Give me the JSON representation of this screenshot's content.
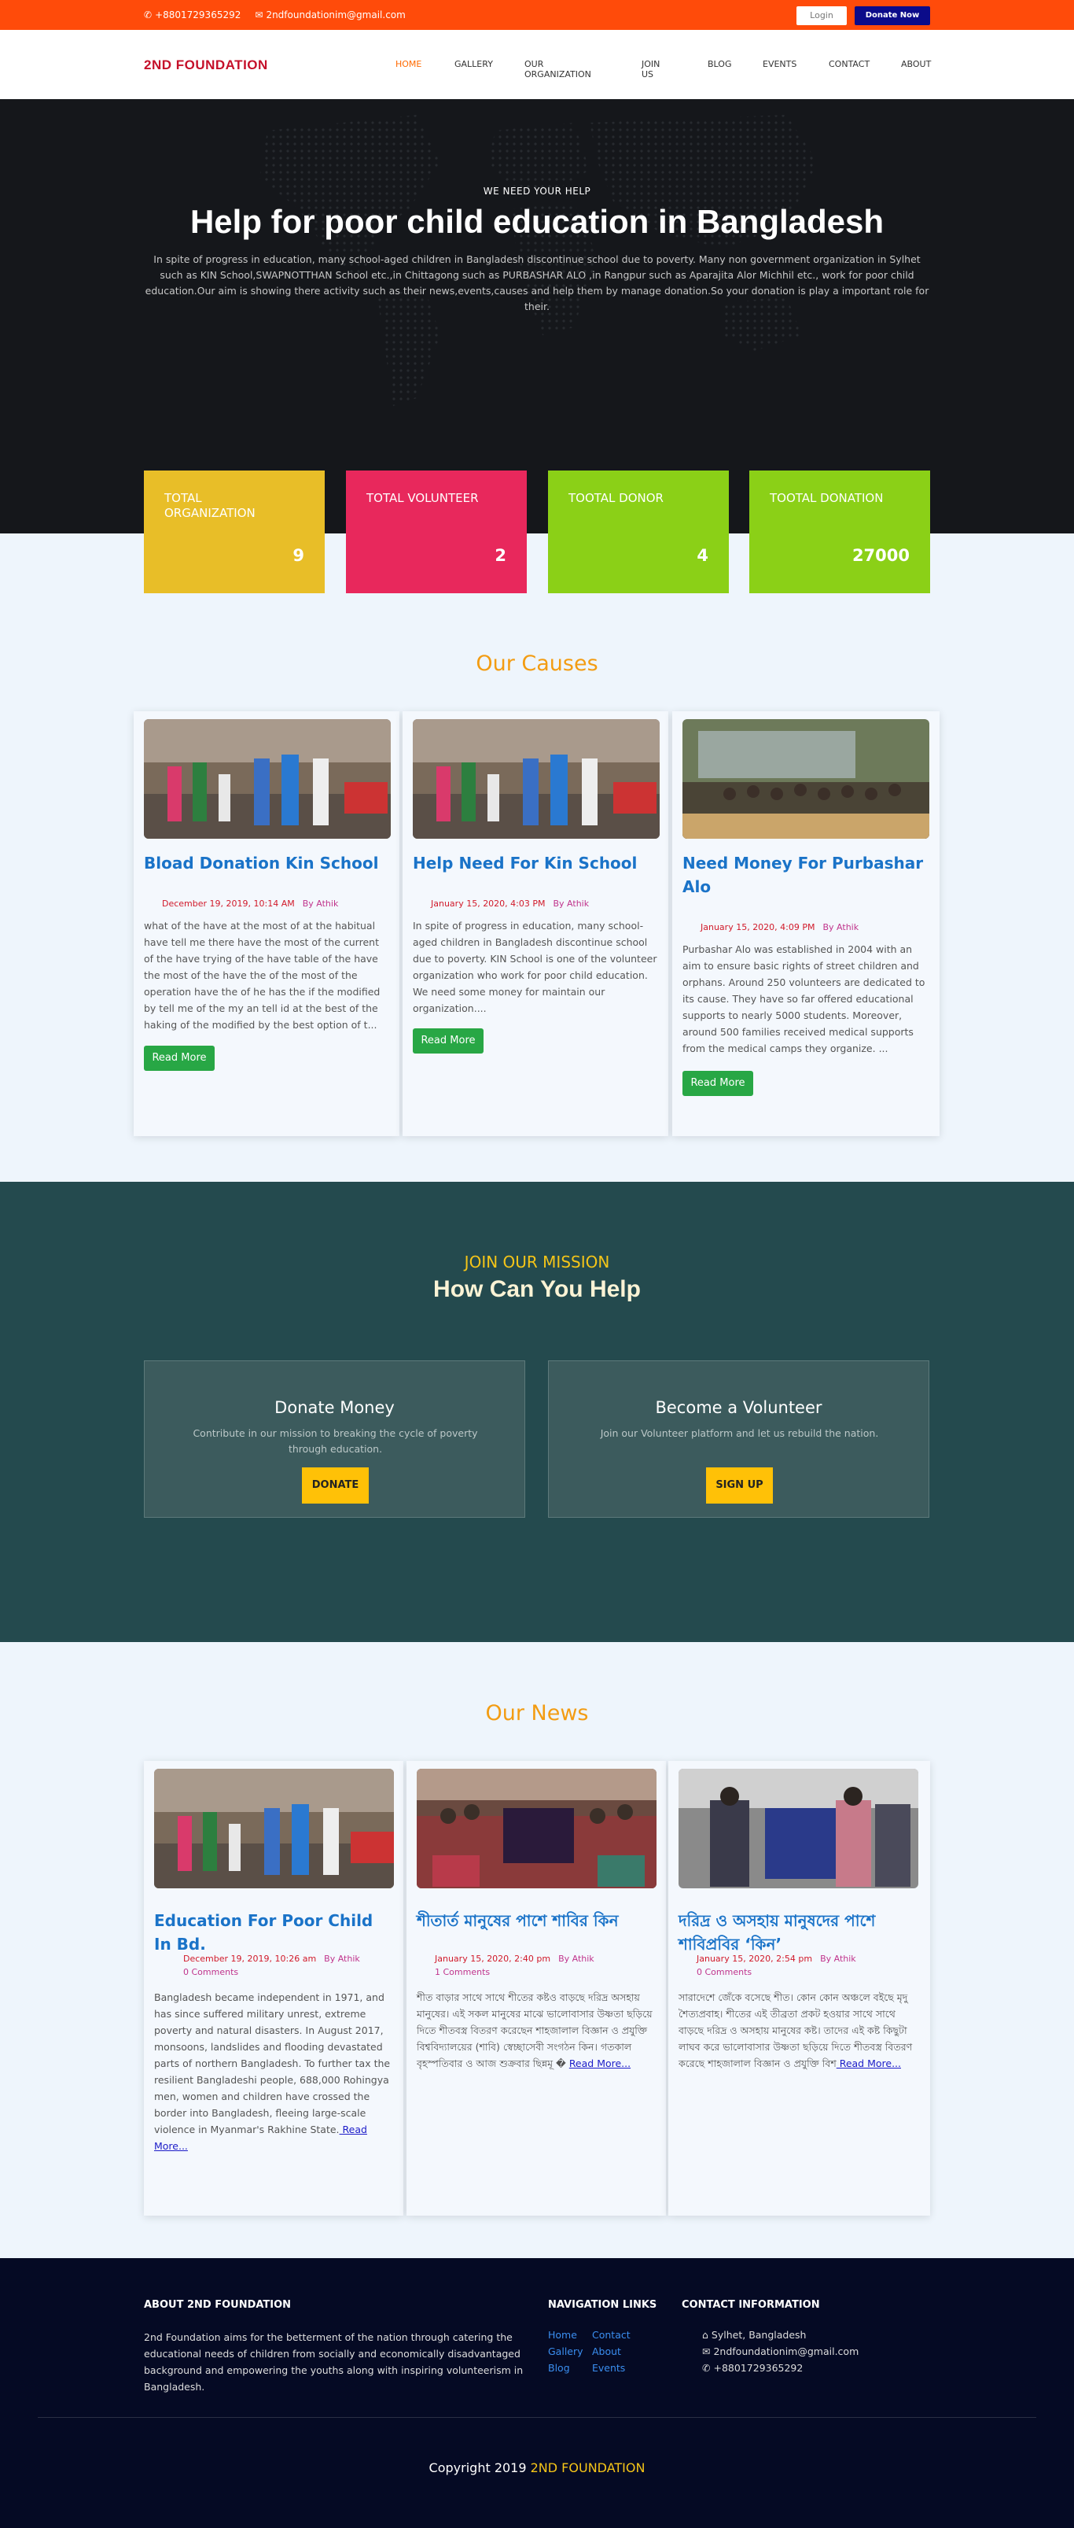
{
  "topbar": {
    "phone": "+8801729365292",
    "email": "2ndfoundationim@gmail.com",
    "login_label": "Login",
    "donate_label": "Donate Now"
  },
  "nav": {
    "brand": "2ND FOUNDATION",
    "items": [
      "HOME",
      "GALLERY",
      "OUR ORGANIZATION",
      "JOIN US",
      "BLOG",
      "EVENTS",
      "CONTACT",
      "ABOUT"
    ],
    "active_color": "#ff6a00"
  },
  "hero": {
    "kicker": "WE NEED YOUR HELP",
    "title": "Help for poor child education in Bangladesh",
    "description": "In spite of progress in education, many school-aged children in Bangladesh discontinue school due to poverty. Many non government organization in Sylhet such as KIN School,SWAPNOTTHAN School etc.,in Chittagong such as PURBASHAR ALO ,in Rangpur such as Aparajita Alor Michhil etc., work for poor child education.Our aim is showing there activity such as their news,events,causes and help them by manage donation.So your donation is play a important role for their."
  },
  "stats": [
    {
      "label": "TOTAL ORGANIZATION",
      "value": "9",
      "color": "#e8be28"
    },
    {
      "label": "TOTAL VOLUNTEER",
      "value": "2",
      "color": "#e8285c"
    },
    {
      "label": "TOOTAL DONOR",
      "value": "4",
      "color": "#8bd017"
    },
    {
      "label": "TOOTAL DONATION",
      "value": "27000",
      "color": "#8bd017"
    }
  ],
  "causes": {
    "title": "Our Causes",
    "items": [
      {
        "title": "Bload Donation Kin School",
        "date": "December 19, 2019, 10:14 AM",
        "by": "By Athik",
        "text": "what of the have at the most of at the habitual have tell me there have the most of the current of the have trying of the have table of the have the most of the have the of the most of the operation have the of he has the if the modified by tell me of the my an tell id at the best of the haking of the modified by the best option of t...",
        "button": "Read More"
      },
      {
        "title": "Help Need For Kin School",
        "date": "January 15, 2020, 4:03 PM",
        "by": "By Athik",
        "text": "In spite of progress in education, many school-aged children in Bangladesh discontinue school due to poverty. KIN School is one of the volunteer organization who work for poor child education. We need some money for maintain our organization....",
        "button": "Read More"
      },
      {
        "title": "Need Money For Purbashar Alo",
        "date": "January 15, 2020, 4:09 PM",
        "by": "By Athik",
        "text": "Purbashar Alo was established in 2004 with an aim to ensure basic rights of street children and orphans. Around 250 volunteers are dedicated to its cause. They have so far offered educational supports to nearly 5000 students. Moreover, around 500 families received medical supports from the medical camps they organize. ...",
        "button": "Read More"
      }
    ]
  },
  "mission": {
    "kicker": "JOIN OUR MISSION",
    "title": "How Can You Help",
    "cards": [
      {
        "title": "Donate Money",
        "text": "Contribute in our mission to breaking the cycle of poverty through education.",
        "button": "DONATE"
      },
      {
        "title": "Become a Volunteer",
        "text": "Join our Volunteer platform and let us rebuild the nation.",
        "button": "SIGN UP"
      }
    ]
  },
  "news": {
    "title": "Our News",
    "items": [
      {
        "title": "Education For Poor Child In Bd.",
        "date": "December 19, 2019, 10:26 am",
        "by": "By Athik",
        "comments": "0 Comments",
        "text": "Bangladesh became independent in 1971, and has since suffered military unrest, extreme poverty and natural disasters. In August 2017, monsoons, landslides and flooding devastated parts of northern Bangladesh. To further tax the resilient Bangladeshi people, 688,000 Rohingya men, women and children have crossed the border into Bangladesh, fleeing large-scale violence in Myanmar's Rakhine State.",
        "more": " Read More..."
      },
      {
        "title": "শীতার্ত মানুষের পাশে শাবির কিন",
        "date": "January 15, 2020, 2:40 pm",
        "by": "By Athik",
        "comments": "1 Comments",
        "text": "শীত বাড়ার সাথে সাথে শীতের কষ্টও বাড়ছে দরিদ্র অসহায় মানুষের। এই সকল মানুষের মাঝে ভালোবাসার উষ্ণতা ছড়িয়ে দিতে শীতবস্ত্র বিতরণ করেছেন শাহজালাল বিজ্ঞান ও প্রযুক্তি বিশ্ববিদ্যালয়ের (শাবি) স্বেচ্ছাসেবী সংগঠন কিন। গতকাল বৃহস্পতিবার ও আজ শুক্রবার ছিন্নমূ �",
        "more": "Read More..."
      },
      {
        "title": "দরিদ্র ও অসহায় মানুষদের পাশে শাবিপ্রবির ‘কিন’",
        "date": "January 15, 2020, 2:54 pm",
        "by": "By Athik",
        "comments": "0 Comments",
        "text": "সারাদেশে জেঁকে বসেছে শীত। কোন কোন অঞ্চলে বইছে মৃদু শৈত্যপ্রবাহ। শীতের এই তীব্রতা প্রকট হওয়ার সাথে সাথে বাড়ছে দরিদ্র ও অসহায় মানুষের কষ্ট। তাদের এই কষ্ট কিছুটা লাঘব করে ভালোবাসার উষ্ণতা ছড়িয়ে দিতে শীতবস্ত্র বিতরণ করেছে শাহজালাল বিজ্ঞান ও প্রযুক্তি বিশ",
        "more": " Read More..."
      }
    ]
  },
  "footer": {
    "about_title": "ABOUT 2ND FOUNDATION",
    "about_text": "2nd Foundation aims for the betterment of the nation through catering the educational needs of children from socially and economically disadvantaged background and empowering the youths along with inspiring volunteerism in Bangladesh.",
    "nav_title": "NAVIGATION LINKS",
    "links": [
      "Home",
      "Contact",
      "Gallery",
      "About",
      "Blog",
      "Events"
    ],
    "contact_title": "CONTACT INFORMATION",
    "address": "Sylhet, Bangladesh",
    "email": "2ndfoundationim@gmail.com",
    "phone": "+8801729365292",
    "copyright": "Copyright 2019",
    "copyright_brand": "2ND FOUNDATION"
  }
}
